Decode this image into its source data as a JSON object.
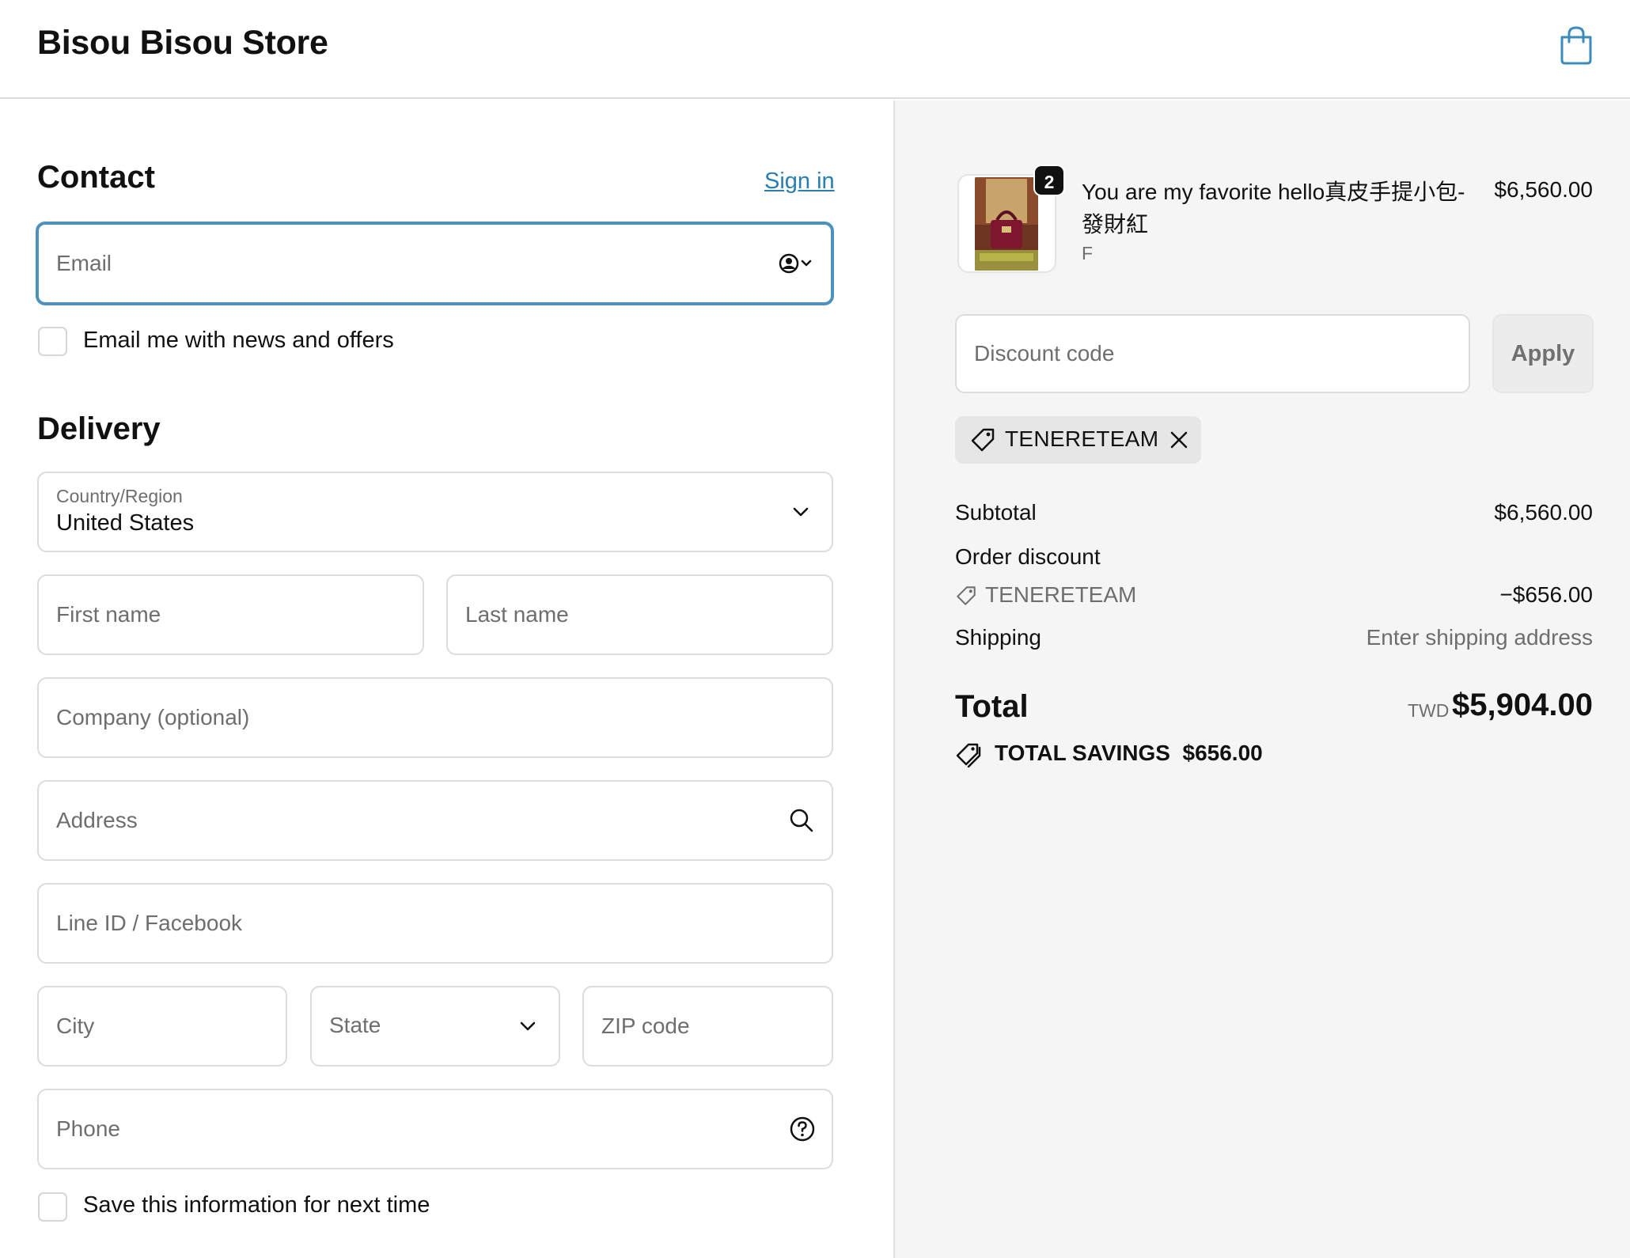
{
  "header": {
    "store_name": "Bisou Bisou Store",
    "cart_icon": "shopping-bag-icon"
  },
  "contact": {
    "title": "Contact",
    "sign_in": "Sign in",
    "email_placeholder": "Email",
    "newsletter_label": "Email me with news and offers"
  },
  "delivery": {
    "title": "Delivery",
    "country_label": "Country/Region",
    "country_value": "United States",
    "first_name_placeholder": "First name",
    "last_name_placeholder": "Last name",
    "company_placeholder": "Company (optional)",
    "address_placeholder": "Address",
    "line_id_placeholder": "Line ID / Facebook",
    "city_placeholder": "City",
    "state_placeholder": "State",
    "zip_placeholder": "ZIP code",
    "phone_placeholder": "Phone",
    "save_info_label": "Save this information for next time"
  },
  "order": {
    "item": {
      "quantity": "2",
      "name": "You are my favorite hello真皮手提小包-發財紅",
      "variant": "F",
      "price": "$6,560.00"
    },
    "discount_placeholder": "Discount code",
    "apply_label": "Apply",
    "applied_code": "TENERETEAM",
    "subtotal_label": "Subtotal",
    "subtotal_value": "$6,560.00",
    "order_discount_label": "Order discount",
    "discount_code_line": "TENERETEAM",
    "discount_value": "−$656.00",
    "shipping_label": "Shipping",
    "shipping_value": "Enter shipping address",
    "total_label": "Total",
    "currency": "TWD",
    "total_value": "$5,904.00",
    "savings_label": "TOTAL SAVINGS",
    "savings_value": "$656.00"
  },
  "colors": {
    "accent": "#2a7fb0",
    "focus_border": "#4d92bd",
    "sidebar_bg": "#f5f5f5"
  }
}
